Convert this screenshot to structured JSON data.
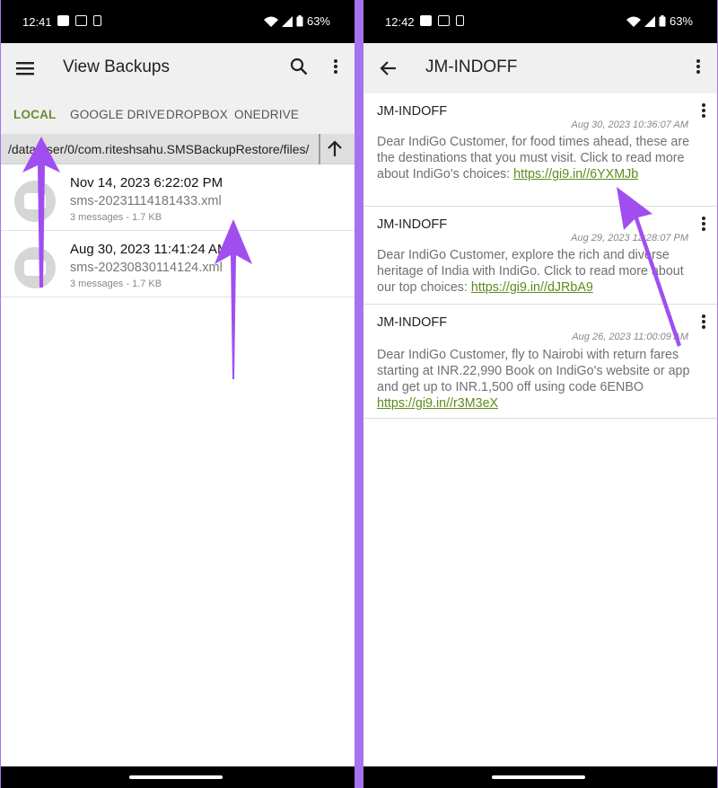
{
  "left": {
    "status": {
      "time": "12:41",
      "battery": "63%"
    },
    "appbar": {
      "title": "View Backups"
    },
    "tabs": [
      "LOCAL",
      "GOOGLE DRIVE",
      "DROPBOX",
      "ONEDRIVE"
    ],
    "path": "/data/user/0/com.riteshsahu.SMSBackupRestore/files/",
    "backups": [
      {
        "date": "Nov 14, 2023 6:22:02 PM",
        "file": "sms-20231114181433.xml",
        "meta": "3 messages - 1.7 KB"
      },
      {
        "date": "Aug 30, 2023 11:41:24 AM",
        "file": "sms-20230830114124.xml",
        "meta": "3 messages - 1.7 KB"
      }
    ]
  },
  "right": {
    "status": {
      "time": "12:42",
      "battery": "63%"
    },
    "appbar": {
      "title": "JM-INDOFF"
    },
    "messages": [
      {
        "sender": "JM-INDOFF",
        "timestamp": "Aug 30, 2023 10:36:07 AM",
        "text": "Dear IndiGo Customer, for food times ahead, these are the destinations that you must visit. Click to read more about IndiGo's choices: ",
        "link": "https://gi9.in//6YXMJb"
      },
      {
        "sender": "JM-INDOFF",
        "timestamp": "Aug 29, 2023 12:28:07 PM",
        "text": "Dear IndiGo Customer, explore the rich and diverse heritage of India with IndiGo. Click to read more about our top choices: ",
        "link": "https://gi9.in//dJRbA9"
      },
      {
        "sender": "JM-INDOFF",
        "timestamp": "Aug 26, 2023 11:00:09 AM",
        "text": "Dear IndiGo Customer, fly to Nairobi with return fares starting at INR.22,990 Book on IndiGo's website or app and get up to INR.1,500 off using code 6ENBO ",
        "link": "https://gi9.in//r3M3eX"
      }
    ]
  },
  "colors": {
    "accent_tab": "#6b8c2f",
    "link": "#5f8a1c",
    "annotation_arrow": "#a14ef0",
    "divider": "#a673f0"
  }
}
